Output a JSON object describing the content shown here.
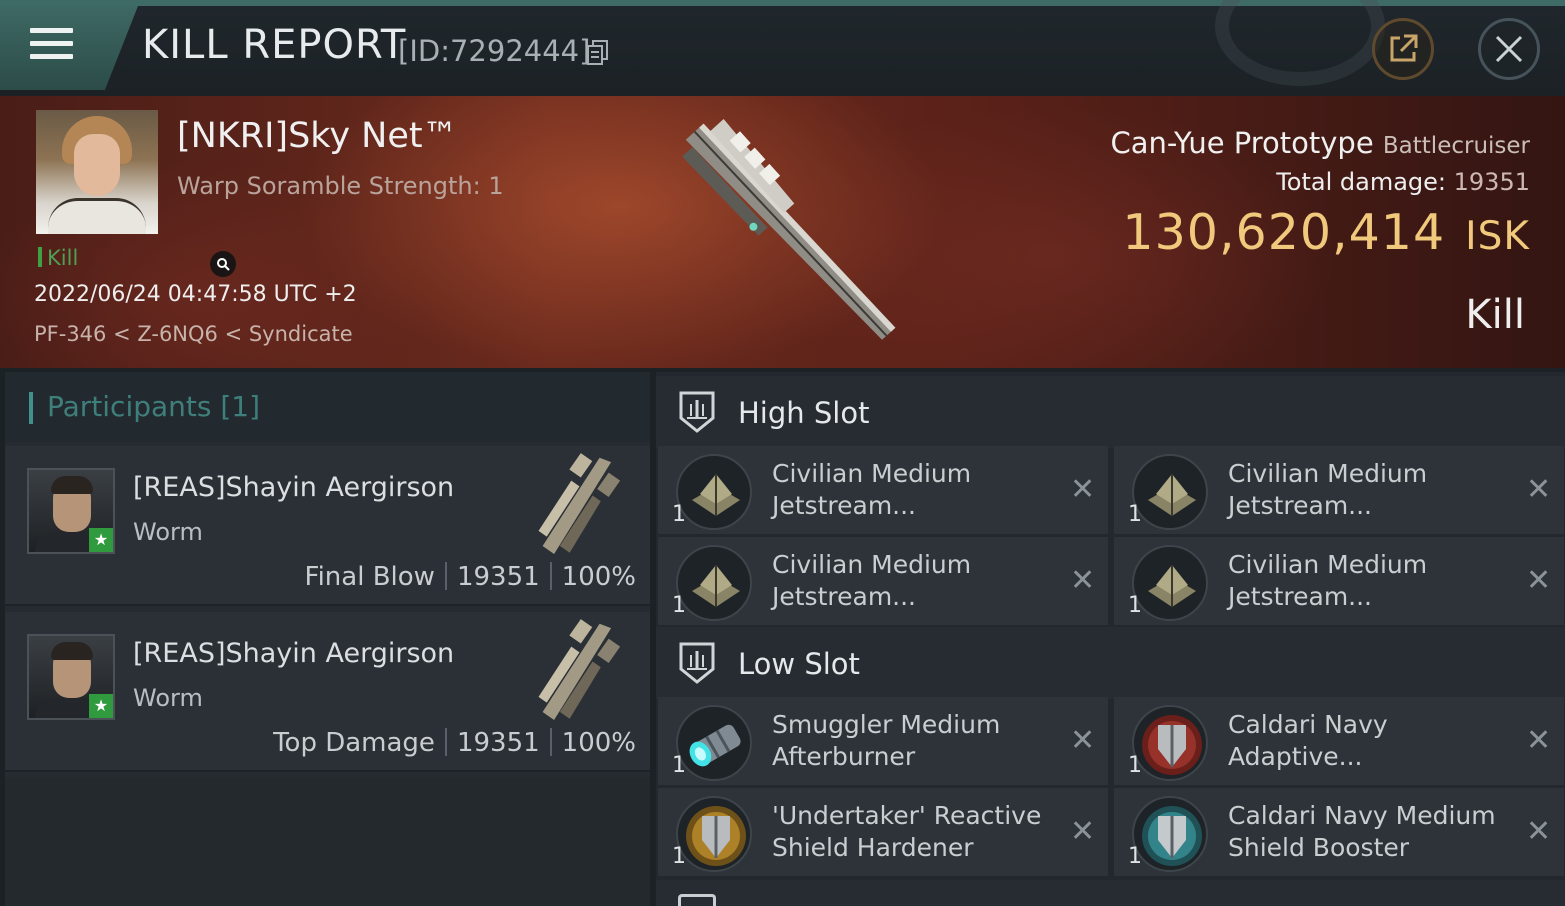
{
  "header": {
    "title": "KILL REPORT",
    "report_id": "[ID:7292444]"
  },
  "victim": {
    "name": "[NKRI]Sky Net™",
    "warp_scramble": "Warp Soramble Strength: 1",
    "kill_tag": "Kill",
    "datetime": "2022/06/24 04:47:58 UTC +2",
    "location": "PF-346 < Z-6NQ6 < Syndicate",
    "ship_name": "Can-Yue Prototype",
    "ship_class": "Battlecruiser",
    "total_damage_label": "Total damage:",
    "total_damage_value": "19351",
    "isk_value": "130,620,414",
    "isk_unit": "ISK",
    "result": "Kill"
  },
  "participants": {
    "title": "Participants [1]",
    "rows": [
      {
        "name": "[REAS]Shayin Aergirson",
        "ship": "Worm",
        "role": "Final Blow",
        "damage": "19351",
        "percent": "100%"
      },
      {
        "name": "[REAS]Shayin Aergirson",
        "ship": "Worm",
        "role": "Top Damage",
        "damage": "19351",
        "percent": "100%"
      }
    ]
  },
  "fitting": {
    "high_slot": {
      "title": "High Slot",
      "items": [
        {
          "name": "Civilian Medium\nJetstream...",
          "qty": "1",
          "icon": "jetstream-icon"
        },
        {
          "name": "Civilian Medium\nJetstream...",
          "qty": "1",
          "icon": "jetstream-icon"
        },
        {
          "name": "Civilian Medium\nJetstream...",
          "qty": "1",
          "icon": "jetstream-icon"
        },
        {
          "name": "Civilian Medium\nJetstream...",
          "qty": "1",
          "icon": "jetstream-icon"
        }
      ]
    },
    "low_slot": {
      "title": "Low Slot",
      "items": [
        {
          "name": "Smuggler Medium\nAfterburner",
          "qty": "1",
          "icon": "afterburner-icon"
        },
        {
          "name": "Caldari Navy\nAdaptive...",
          "qty": "1",
          "icon": "shield-hardener-red-icon"
        },
        {
          "name": "'Undertaker' Reactive\n Shield Hardener",
          "qty": "1",
          "icon": "shield-hardener-gold-icon"
        },
        {
          "name": "Caldari Navy Medium\nShield Booster",
          "qty": "1",
          "icon": "shield-booster-icon"
        }
      ]
    }
  },
  "colors": {
    "accent_teal": "#3f6b66",
    "isk_gold": "#f1c97c",
    "kill_green": "#3fa046"
  }
}
